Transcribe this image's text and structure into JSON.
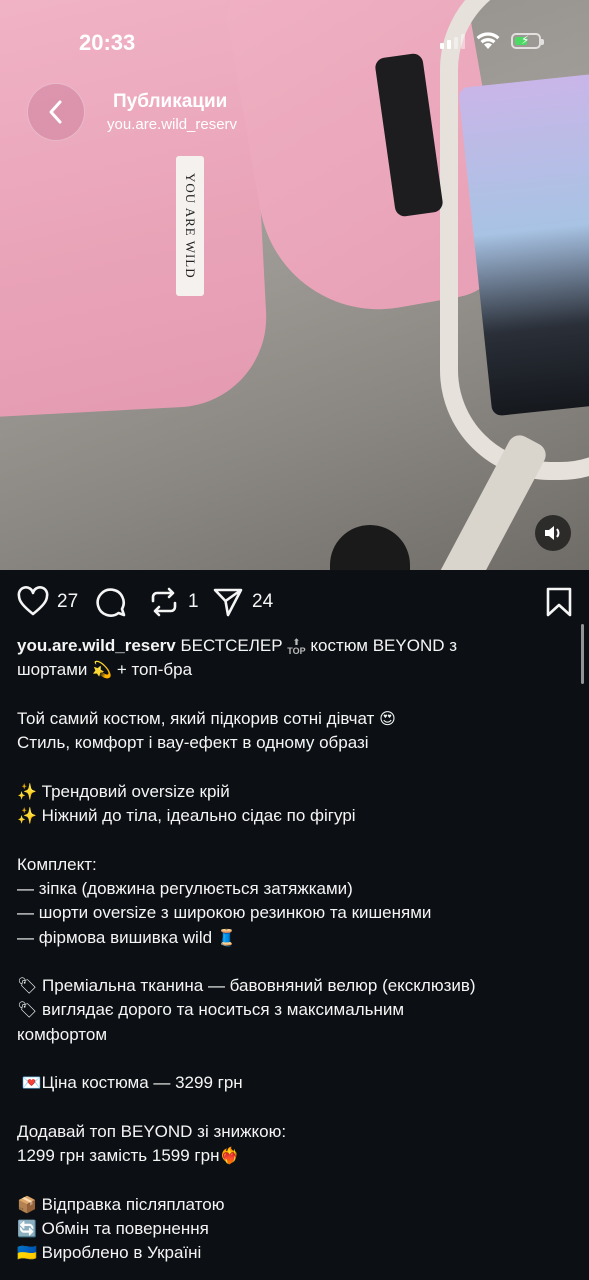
{
  "status_bar": {
    "time": "20:33"
  },
  "header": {
    "title": "Публикации",
    "subtitle": "you.are.wild_reserv"
  },
  "media": {
    "tag_text": "YOU ARE WILD"
  },
  "actions": {
    "likes": "27",
    "comments": "",
    "reposts": "1",
    "shares": "24"
  },
  "caption": {
    "username": "you.are.wild_reserv",
    "line1_rest": "БЕСТСЕЛЕР",
    "top_badge": "TOP",
    "line1_tail": "костюм BEYOND з",
    "line2": "шортами",
    "line2_tail": "+ топ-бра",
    "p1_l1": "Той самий костюм, який підкорив сотні дівчат",
    "p1_l2": "Стиль, комфорт і вау-ефект в одному образі",
    "p2_l1": "Трендовий oversize крій",
    "p2_l2": "Ніжний до тіла, ідеально сідає по фігурі",
    "p3_title": "Комплект:",
    "p3_l1": "— зіпка (довжина регулюється затяжками)",
    "p3_l2": "— шорти oversize з широкою резинкою та кишенями",
    "p3_l3": "— фірмова вишивка wild",
    "p4_l1": "Преміальна тканина — бавовняний велюр (ексклюзив)",
    "p4_l2": "виглядає дорого та носиться з максимальним",
    "p4_l3": "комфортом",
    "price": "Ціна костюма — 3299 грн",
    "p6_l1": "Додавай топ BEYOND зі знижкою:",
    "p6_l2": "1299 грн замість 1599 грн",
    "p7_l1": "Відправка післяплатою",
    "p7_l2": "Обмін та повернення",
    "p7_l3": "Вироблено в Україні"
  },
  "colors": {
    "background": "#0c1014",
    "text": "#f5f5f5",
    "media_pink": "#eba6bb"
  }
}
